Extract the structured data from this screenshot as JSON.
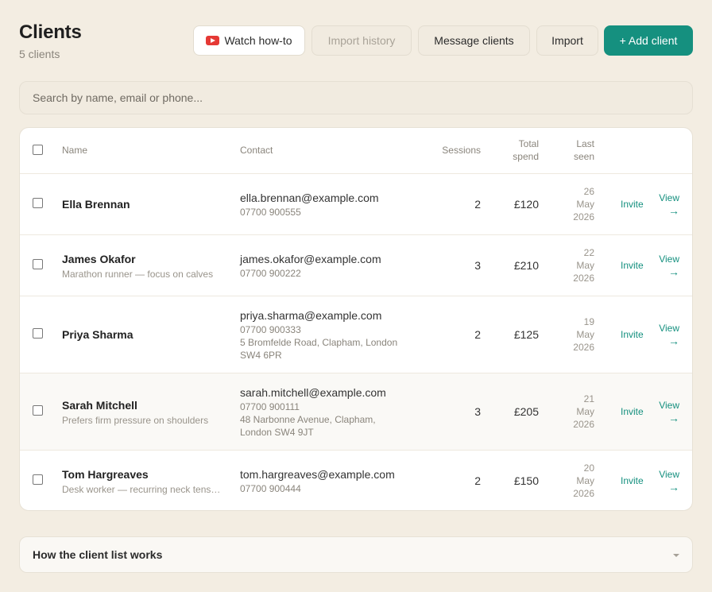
{
  "header": {
    "title": "Clients",
    "subtitle": "5 clients"
  },
  "toolbar": {
    "watch_label": "Watch how-to",
    "import_history_label": "Import history",
    "message_label": "Message clients",
    "import_label": "Import",
    "add_label": "+ Add client"
  },
  "search": {
    "placeholder": "Search by name, email or phone..."
  },
  "table": {
    "headers": {
      "name": "Name",
      "contact": "Contact",
      "sessions": "Sessions",
      "spend_line1": "Total",
      "spend_line2": "spend",
      "seen_line1": "Last",
      "seen_line2": "seen"
    },
    "rows": [
      {
        "name": "Ella Brennan",
        "note": "",
        "email": "ella.brennan@example.com",
        "phone": "07700 900555",
        "address1": "",
        "address2": "",
        "sessions": "2",
        "spend": "£120",
        "seen_day": "26",
        "seen_month": "May",
        "seen_year": "2026",
        "invite": "Invite",
        "view": "View",
        "view_arrow": "→"
      },
      {
        "name": "James Okafor",
        "note": "Marathon runner — focus on calves",
        "email": "james.okafor@example.com",
        "phone": "07700 900222",
        "address1": "",
        "address2": "",
        "sessions": "3",
        "spend": "£210",
        "seen_day": "22",
        "seen_month": "May",
        "seen_year": "2026",
        "invite": "Invite",
        "view": "View",
        "view_arrow": "→"
      },
      {
        "name": "Priya Sharma",
        "note": "",
        "email": "priya.sharma@example.com",
        "phone": "07700 900333",
        "address1": "5 Bromfelde Road, Clapham, London",
        "address2": "SW4 6PR",
        "sessions": "2",
        "spend": "£125",
        "seen_day": "19",
        "seen_month": "May",
        "seen_year": "2026",
        "invite": "Invite",
        "view": "View",
        "view_arrow": "→"
      },
      {
        "name": "Sarah Mitchell",
        "note": "Prefers firm pressure on shoulders",
        "email": "sarah.mitchell@example.com",
        "phone": "07700 900111",
        "address1": "48 Narbonne Avenue, Clapham,",
        "address2": "London SW4 9JT",
        "sessions": "3",
        "spend": "£205",
        "seen_day": "21",
        "seen_month": "May",
        "seen_year": "2026",
        "invite": "Invite",
        "view": "View",
        "view_arrow": "→"
      },
      {
        "name": "Tom Hargreaves",
        "note": "Desk worker — recurring neck tension",
        "email": "tom.hargreaves@example.com",
        "phone": "07700 900444",
        "address1": "",
        "address2": "",
        "sessions": "2",
        "spend": "£150",
        "seen_day": "20",
        "seen_month": "May",
        "seen_year": "2026",
        "invite": "Invite",
        "view": "View",
        "view_arrow": "→"
      }
    ]
  },
  "faq": {
    "label": "How the client list works"
  },
  "colors": {
    "accent": "#15907f",
    "background": "#f3ede2",
    "youtube": "#e53935"
  },
  "icons": {
    "watch": "youtube-play-icon",
    "faq": "chevron-down-icon",
    "view": "arrow-right-icon"
  }
}
